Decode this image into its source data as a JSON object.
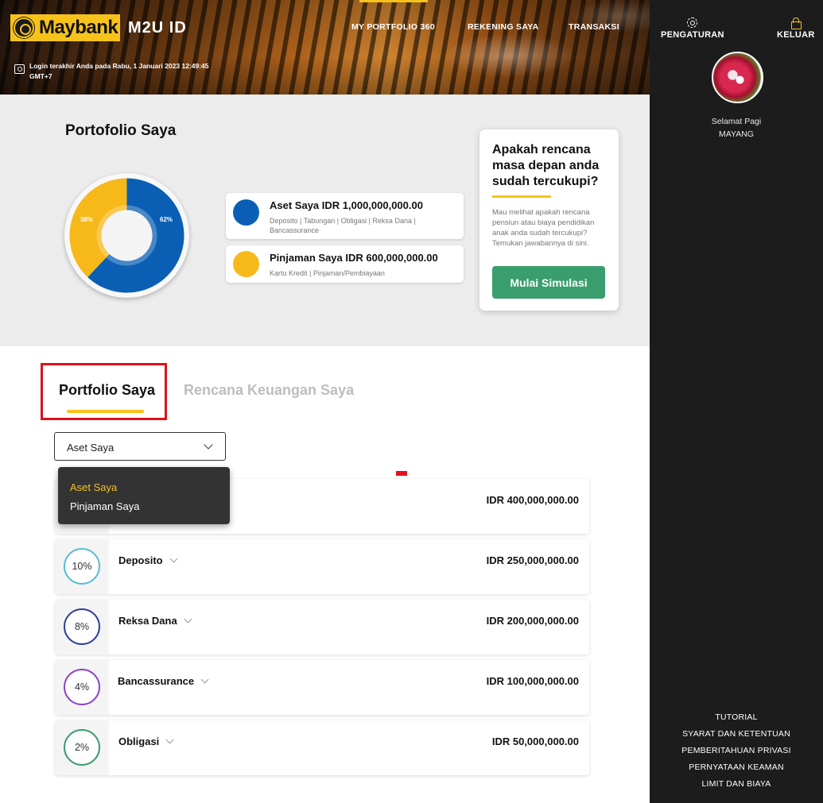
{
  "header": {
    "logo_text": "Maybank",
    "app_name": "M2U ID",
    "last_login": "Login terakhir Anda pada Rabu, 1 Januari 2023 12:49:45 GMT+7",
    "nav": [
      {
        "label": "MY PORTFOLIO 360",
        "active": true
      },
      {
        "label": "REKENING SAYA",
        "active": false
      },
      {
        "label": "TRANSAKSI",
        "active": false
      }
    ]
  },
  "sidebar": {
    "settings_label": "PENGATURAN",
    "logout_label": "KELUAR",
    "greeting": "Selamat Pagi",
    "user_name": "MAYANG",
    "footer_links": [
      "TUTORIAL",
      "SYARAT DAN KETENTUAN",
      "PEMBERITAHUAN PRIVASI",
      "PERNYATAAN KEAMAN",
      "LIMIT DAN BIAYA"
    ]
  },
  "summary": {
    "title": "Portofolio Saya",
    "legend": [
      {
        "title": "Aset Saya  IDR 1,000,000,000.00",
        "sub": "Deposito | Tabungan | Obligasi | Reksa Dana | Bancassurance",
        "color": "#0a5fb4"
      },
      {
        "title": "Pinjaman Saya  IDR 600,000,000.00",
        "sub": "Kartu Kredit | Pinjaman/Pembiayaan",
        "color": "#f7b81a"
      }
    ]
  },
  "chart_data": {
    "type": "pie",
    "categories": [
      "Aset Saya",
      "Pinjaman Saya"
    ],
    "values": [
      62,
      38
    ],
    "labels": [
      "62%",
      "38%"
    ],
    "colors": [
      "#0a5fb4",
      "#f7b81a"
    ]
  },
  "simulation": {
    "title": "Apakah rencana masa depan anda sudah tercukupi?",
    "text": "Mau melihat apakah rencana pensiun atau biaya pendidikan anak anda sudah tercukupi? Temukan jawabannya di sini.",
    "button": "Mulai Simulasi"
  },
  "tabs": [
    {
      "label": "Portfolio Saya",
      "active": true
    },
    {
      "label": "Rencana Keuangan Saya",
      "active": false
    }
  ],
  "filter": {
    "selected": "Aset Saya",
    "options": [
      "Aset Saya",
      "Pinjaman Saya"
    ]
  },
  "assets": [
    {
      "name": "",
      "percent": "",
      "amount": "IDR 400,000,000.00",
      "color": "#3a9d6e"
    },
    {
      "name": "Deposito",
      "percent": "10%",
      "amount": "IDR 250,000,000.00",
      "color": "#5bbcd6"
    },
    {
      "name": "Reksa Dana",
      "percent": "8%",
      "amount": "IDR 200,000,000.00",
      "color": "#2f3f9e"
    },
    {
      "name": "Bancassurance",
      "percent": "4%",
      "amount": "IDR 100,000,000.00",
      "color": "#8e44c9"
    },
    {
      "name": "Obligasi",
      "percent": "2%",
      "amount": "IDR 50,000,000.00",
      "color": "#3a9d6e"
    }
  ]
}
